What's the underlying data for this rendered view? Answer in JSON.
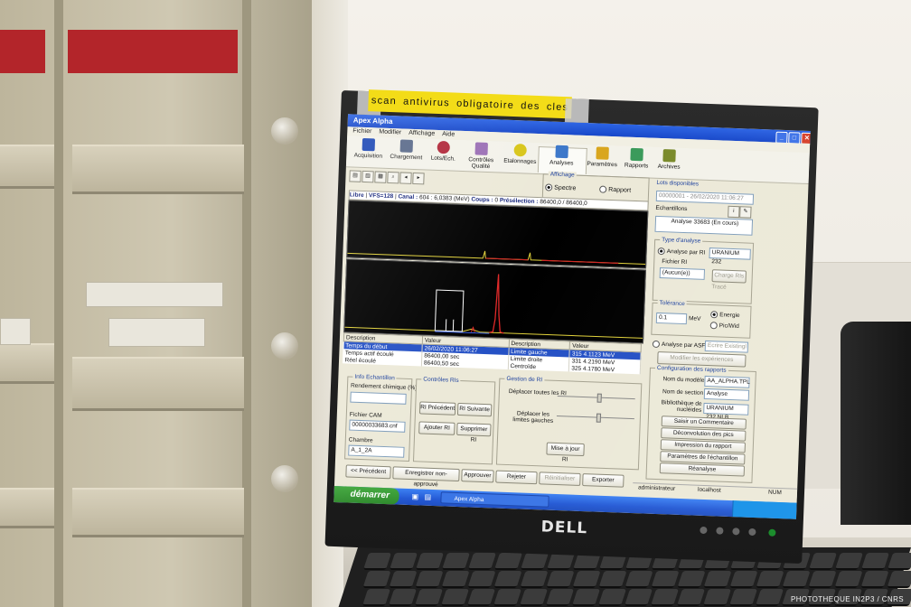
{
  "sticker": "scan antivirus obligatoire des cles USB",
  "brand": "DELL",
  "photo_credit": "PHOTOTHEQUE IN2P3 / CNRS",
  "app": {
    "title": "Apex Alpha",
    "menu": [
      "Fichier",
      "Modifier",
      "Affichage",
      "Aide"
    ],
    "toolbar": [
      "Acquisition",
      "Chargement",
      "Lots/Ech.",
      "Contrôles Qualité",
      "Etalonnages",
      "Analyses",
      "Paramètres",
      "Rapports",
      "Archives"
    ]
  },
  "affichage": {
    "title": "Affichage",
    "options": [
      "Spectre",
      "Rapport"
    ]
  },
  "status": {
    "mode": "Libre",
    "vfs": "VFS=128",
    "canal_label": "Canal :",
    "canal_value": "604 : 6,0383 (MeV)",
    "coups_label": "Coups :",
    "coups_value": "0",
    "preselection_label": "Présélection :",
    "preselection_value": "86400,0 / 86400,0"
  },
  "table": {
    "headers": [
      "Description",
      "Valeur",
      "Description",
      "Valeur"
    ],
    "rows": [
      [
        "Temps du début",
        "26/02/2020 11:06:27",
        "Limite gauche",
        "315    4.1123 MeV"
      ],
      [
        "Temps actif écoulé",
        "86400,00 sec",
        "Limite droite",
        "331    4.2190 MeV"
      ],
      [
        "Réel écoulé",
        "86400,50 sec",
        "Centroïde",
        "325    4.1780 MeV"
      ]
    ]
  },
  "info": {
    "title": "Info Echantillon",
    "rendement_label": "Rendement chimique (%)",
    "fichier_label": "Fichier CAM",
    "fichier_value": "00000033683.cnf",
    "chambre_label": "Chambre",
    "chambre_value": "A_1_2A"
  },
  "controles": {
    "title": "Contrôles RIs",
    "buttons": [
      "RI Précédent",
      "RI Suivante",
      "Ajouter RI",
      "Supprimer RI"
    ]
  },
  "gestion": {
    "title": "Gestion de RI",
    "deplacer_toutes": "Déplacer toutes les RI",
    "deplacer_limites": "Déplacer les limites gauches",
    "maj_button": "Mise à jour RI"
  },
  "bottom_buttons": [
    "<< Précédent",
    "Enregistrer non-approuvé",
    "Approuver",
    "Rejeter",
    "Réinitialiser",
    "Exporter"
  ],
  "right": {
    "lots_title": "Lots disponibles",
    "lot_value": "00000001 - 26/02/2020 11:06:27",
    "echantillons_label": "Echantillons",
    "echantillon_item": "Analyse 33683 (En cours)",
    "type_title": "Type d'analyse",
    "type_option": "Analyse par RI",
    "type_value": "URANIUM 232",
    "fichier_ri_label": "Fichier RI",
    "fichier_ri_value": "(Aucun(e))",
    "charge_button": "Charge RIs",
    "trace_label": "Tracé",
    "tolerance_title": "Tolérance",
    "tolerance_value": "0.1",
    "tolerance_unit": "MeV",
    "tolerance_options": [
      "Energie",
      "Pic/Wid"
    ],
    "asf_option": "Analyse par ASF",
    "asf_value": "Ecrire Existingl",
    "asf_button": "Modifier les expériences d'analyse",
    "config_title": "Configuration des rapports",
    "nom_modele_label": "Nom du modèle",
    "nom_modele_value": "AA_ALPHA.TPL",
    "nom_section_label": "Nom de section",
    "nom_section_value": "Analyse",
    "bib_label": "Bibliothèque de nucléides",
    "bib_value": "URANIUM 232.NLB",
    "action_buttons": [
      "Saisir un Commentaire",
      "Déconvolution des pics",
      "Impression du rapport",
      "Paramètres de l'échantillon",
      "Réanalyse"
    ]
  },
  "xp_status": {
    "user": "administrateur",
    "host": "localhost",
    "num": "NUM"
  },
  "taskbar": {
    "start": "démarrer",
    "task": "Apex Alpha"
  }
}
